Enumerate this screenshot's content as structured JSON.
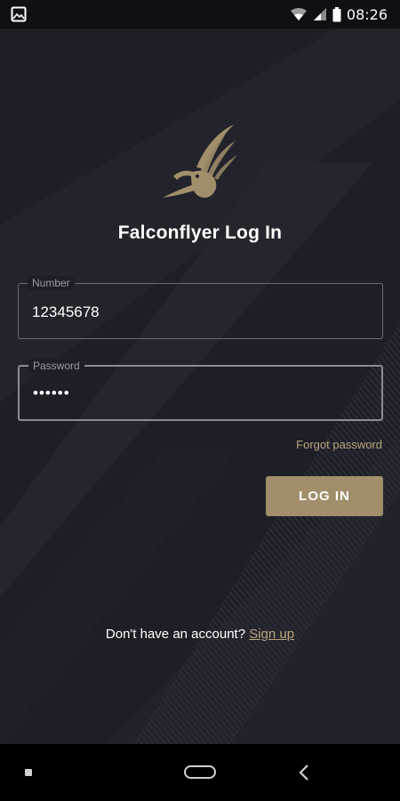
{
  "status_bar": {
    "time": "08:26",
    "icons": [
      "image-icon",
      "wifi-icon",
      "signal-icon",
      "battery-icon"
    ]
  },
  "app": {
    "brand": "Falconflyer",
    "title": "Falconflyer Log In",
    "accent_color": "#a08f6a",
    "link_color": "#b9a67c",
    "background_color": "#1e1e27"
  },
  "form": {
    "number": {
      "label": "Number",
      "value": "12345678"
    },
    "password": {
      "label": "Password",
      "value": "••••••"
    },
    "forgot_password": "Forgot password",
    "login_button": "LOG IN"
  },
  "footer": {
    "prompt": "Don't have an account?",
    "signup_link": "Sign up"
  },
  "nav_bar": {
    "icons": [
      "recent-apps-icon",
      "home-icon",
      "back-icon"
    ]
  }
}
